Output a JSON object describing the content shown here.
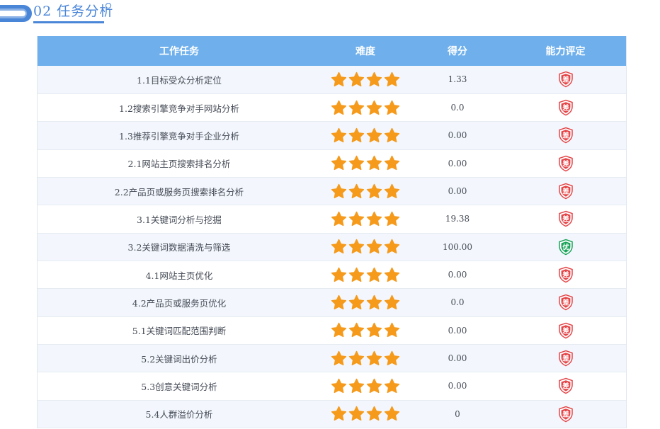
{
  "section": {
    "title": "02 任务分析"
  },
  "colors": {
    "accent": "#4a86d8",
    "header_bg": "#6fb0ec",
    "star": "#f59a1b",
    "poor": "#e4474a",
    "excellent": "#1aa35a"
  },
  "table": {
    "headers": {
      "task": "工作任务",
      "difficulty": "难度",
      "score": "得分",
      "rating": "能力评定"
    },
    "rows": [
      {
        "task": "1.1目标受众分析定位",
        "stars": 4,
        "score": "1.33",
        "rating": "差",
        "rating_level": "poor"
      },
      {
        "task": "1.2搜索引擎竞争对手网站分析",
        "stars": 4,
        "score": "0.0",
        "rating": "差",
        "rating_level": "poor"
      },
      {
        "task": "1.3推荐引擎竞争对手企业分析",
        "stars": 4,
        "score": "0.00",
        "rating": "差",
        "rating_level": "poor"
      },
      {
        "task": "2.1网站主页搜索排名分析",
        "stars": 4,
        "score": "0.00",
        "rating": "差",
        "rating_level": "poor"
      },
      {
        "task": "2.2产品页或服务页搜索排名分析",
        "stars": 4,
        "score": "0.00",
        "rating": "差",
        "rating_level": "poor"
      },
      {
        "task": "3.1关键词分析与挖掘",
        "stars": 4,
        "score": "19.38",
        "rating": "差",
        "rating_level": "poor"
      },
      {
        "task": "3.2关键词数据清洗与筛选",
        "stars": 4,
        "score": "100.00",
        "rating": "优",
        "rating_level": "excellent"
      },
      {
        "task": "4.1网站主页优化",
        "stars": 4,
        "score": "0.00",
        "rating": "差",
        "rating_level": "poor"
      },
      {
        "task": "4.2产品页或服务页优化",
        "stars": 4,
        "score": "0.0",
        "rating": "差",
        "rating_level": "poor"
      },
      {
        "task": "5.1关键词匹配范围判断",
        "stars": 4,
        "score": "0.00",
        "rating": "差",
        "rating_level": "poor"
      },
      {
        "task": "5.2关键词出价分析",
        "stars": 4,
        "score": "0.00",
        "rating": "差",
        "rating_level": "poor"
      },
      {
        "task": "5.3创意关键词分析",
        "stars": 4,
        "score": "0.00",
        "rating": "差",
        "rating_level": "poor"
      },
      {
        "task": "5.4人群溢价分析",
        "stars": 4,
        "score": "0",
        "rating": "差",
        "rating_level": "poor"
      }
    ]
  }
}
